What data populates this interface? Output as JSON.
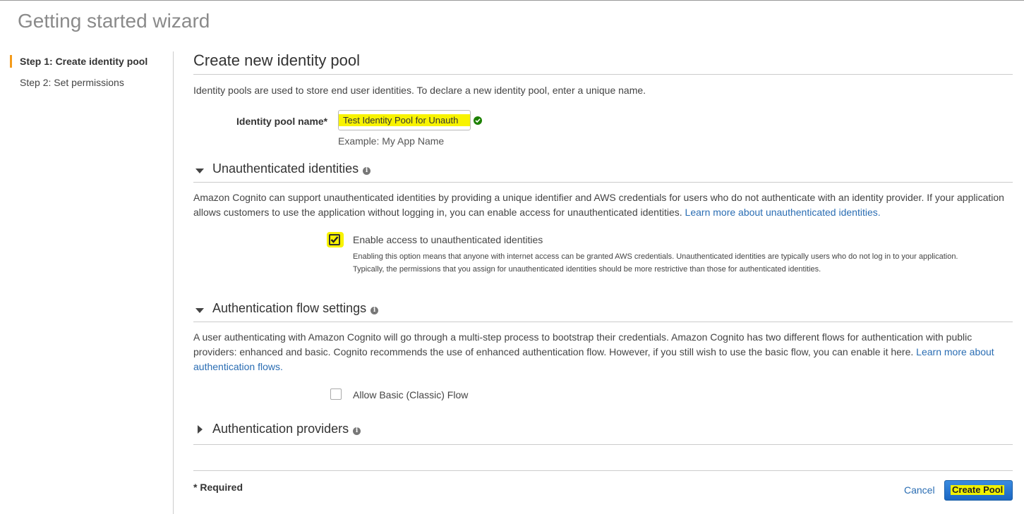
{
  "page": {
    "title": "Getting started wizard"
  },
  "sidebar": {
    "items": [
      {
        "label": "Step 1: Create identity pool",
        "active": true
      },
      {
        "label": "Step 2: Set permissions",
        "active": false
      }
    ]
  },
  "main": {
    "heading": "Create new identity pool",
    "intro": "Identity pools are used to store end user identities. To declare a new identity pool, enter a unique name.",
    "pool_name": {
      "label": "Identity pool name*",
      "value": "Test Identity Pool for Unauth",
      "example": "Example: My App Name"
    },
    "unauth": {
      "title": "Unauthenticated identities",
      "text": "Amazon Cognito can support unauthenticated identities by providing a unique identifier and AWS credentials for users who do not authenticate with an identity provider. If your application allows customers to use the application without logging in, you can enable access for unauthenticated identities.",
      "link": "Learn more about unauthenticated identities.",
      "checkbox_label": "Enable access to unauthenticated identities",
      "checkbox_checked": true,
      "checkbox_desc_1": "Enabling this option means that anyone with internet access can be granted AWS credentials. Unauthenticated identities are typically users who do not log in to your application.",
      "checkbox_desc_2": "Typically, the permissions that you assign for unauthenticated identities should be more restrictive than those for authenticated identities."
    },
    "authflow": {
      "title": "Authentication flow settings",
      "text": "A user authenticating with Amazon Cognito will go through a multi-step process to bootstrap their credentials. Amazon Cognito has two different flows for authentication with public providers: enhanced and basic. Cognito recommends the use of enhanced authentication flow. However, if you still wish to use the basic flow, you can enable it here.",
      "link": "Learn more about authentication flows.",
      "checkbox_label": "Allow Basic (Classic) Flow",
      "checkbox_checked": false
    },
    "providers": {
      "title": "Authentication providers"
    },
    "footer": {
      "required": "* Required",
      "cancel": "Cancel",
      "create": "Create Pool"
    }
  },
  "colors": {
    "accent": "#f49b1a",
    "link": "#2a6db3",
    "primary_button": "#1a66c2",
    "highlight": "#f8f300",
    "success": "#1d8102"
  }
}
